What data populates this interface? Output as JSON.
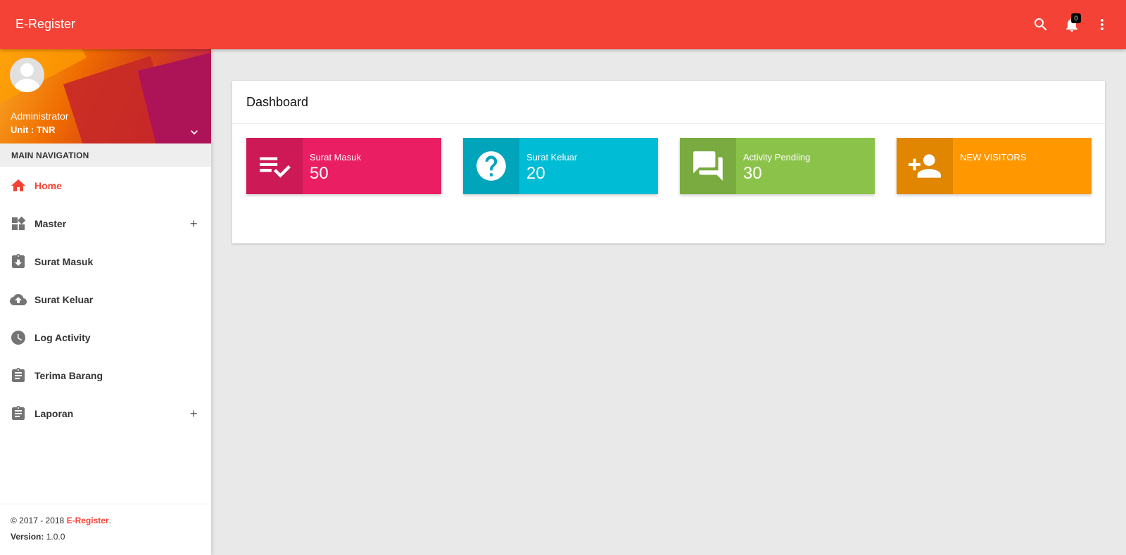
{
  "app": {
    "title": "E-Register",
    "notification_count": "0"
  },
  "user": {
    "name": "Administrator",
    "unit": "Unit : TNR"
  },
  "sidebar": {
    "nav_header": "MAIN NAVIGATION",
    "items": [
      {
        "label": "Home",
        "icon": "home-icon",
        "active": true,
        "expandable": false
      },
      {
        "label": "Master",
        "icon": "widgets-icon",
        "active": false,
        "expandable": true
      },
      {
        "label": "Surat Masuk",
        "icon": "assignment-returned-icon",
        "active": false,
        "expandable": false
      },
      {
        "label": "Surat Keluar",
        "icon": "cloud-upload-icon",
        "active": false,
        "expandable": false
      },
      {
        "label": "Log Activity",
        "icon": "clock-icon",
        "active": false,
        "expandable": false
      },
      {
        "label": "Terima Barang",
        "icon": "clipboard-icon",
        "active": false,
        "expandable": false
      },
      {
        "label": "Laporan",
        "icon": "clipboard-icon",
        "active": false,
        "expandable": true
      }
    ],
    "plus_symbol": "+"
  },
  "footer": {
    "copyright_prefix": "© 2017 - 2018 ",
    "copyright_brand": "E-Register",
    "copyright_suffix": ".",
    "version_label": "Version:",
    "version_value": " 1.0.0"
  },
  "dashboard": {
    "title": "Dashboard",
    "boxes": [
      {
        "text": "Surat Masuk",
        "number": "50",
        "icon": "playlist-check-icon",
        "color": "#e91e63",
        "icon_bg": "#cd1a56"
      },
      {
        "text": "Surat Keluar",
        "number": "20",
        "icon": "help-icon",
        "color": "#00bcd4",
        "icon_bg": "#00a5bb"
      },
      {
        "text": "Activity Pendiing",
        "number": "30",
        "icon": "forum-icon",
        "color": "#8bc34a",
        "icon_bg": "#7aab41"
      },
      {
        "text": "NEW VISITORS",
        "number": "",
        "icon": "person-add-icon",
        "color": "#ff9800",
        "icon_bg": "#e08600"
      }
    ]
  },
  "colors": {
    "primary": "#f44336",
    "background": "#e9e9e9"
  }
}
